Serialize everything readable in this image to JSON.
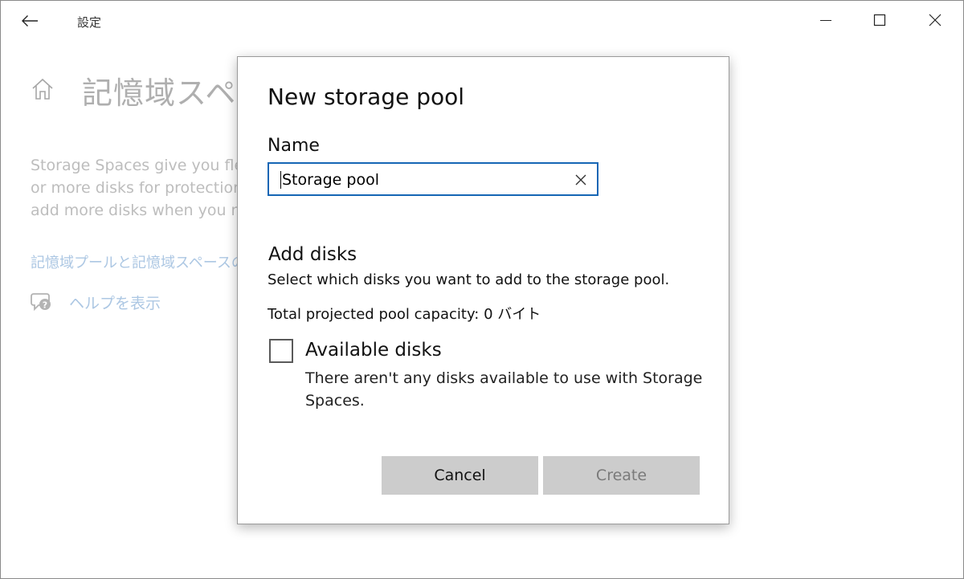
{
  "window": {
    "title": "設定"
  },
  "background_page": {
    "title": "記憶域スペ",
    "description_lines": [
      "Storage Spaces give you flex",
      "or more disks for protection",
      "add more disks when you ru"
    ],
    "link": "記憶域プールと記憶域スペースの",
    "help_label": "ヘルプを表示"
  },
  "dialog": {
    "title": "New storage pool",
    "name_label": "Name",
    "name_value": "Storage pool",
    "add_disks_heading": "Add disks",
    "add_disks_description": "Select which disks you want to add to the storage pool.",
    "capacity_text": "Total projected pool capacity: 0 バイト",
    "available_disks_label": "Available disks",
    "available_disks_checked": false,
    "available_disks_message": "There aren't any disks available to use with Storage Spaces.",
    "cancel_label": "Cancel",
    "create_label": "Create",
    "create_enabled": false
  },
  "colors": {
    "accent": "#1566b5",
    "link": "#80a9d4",
    "button_bg": "#cccccc"
  },
  "icons": {
    "back": "back-arrow-icon",
    "minimize": "minimize-icon",
    "maximize": "maximize-icon",
    "close": "close-icon",
    "home": "home-icon",
    "help": "help-chat-icon",
    "clear": "clear-icon"
  }
}
